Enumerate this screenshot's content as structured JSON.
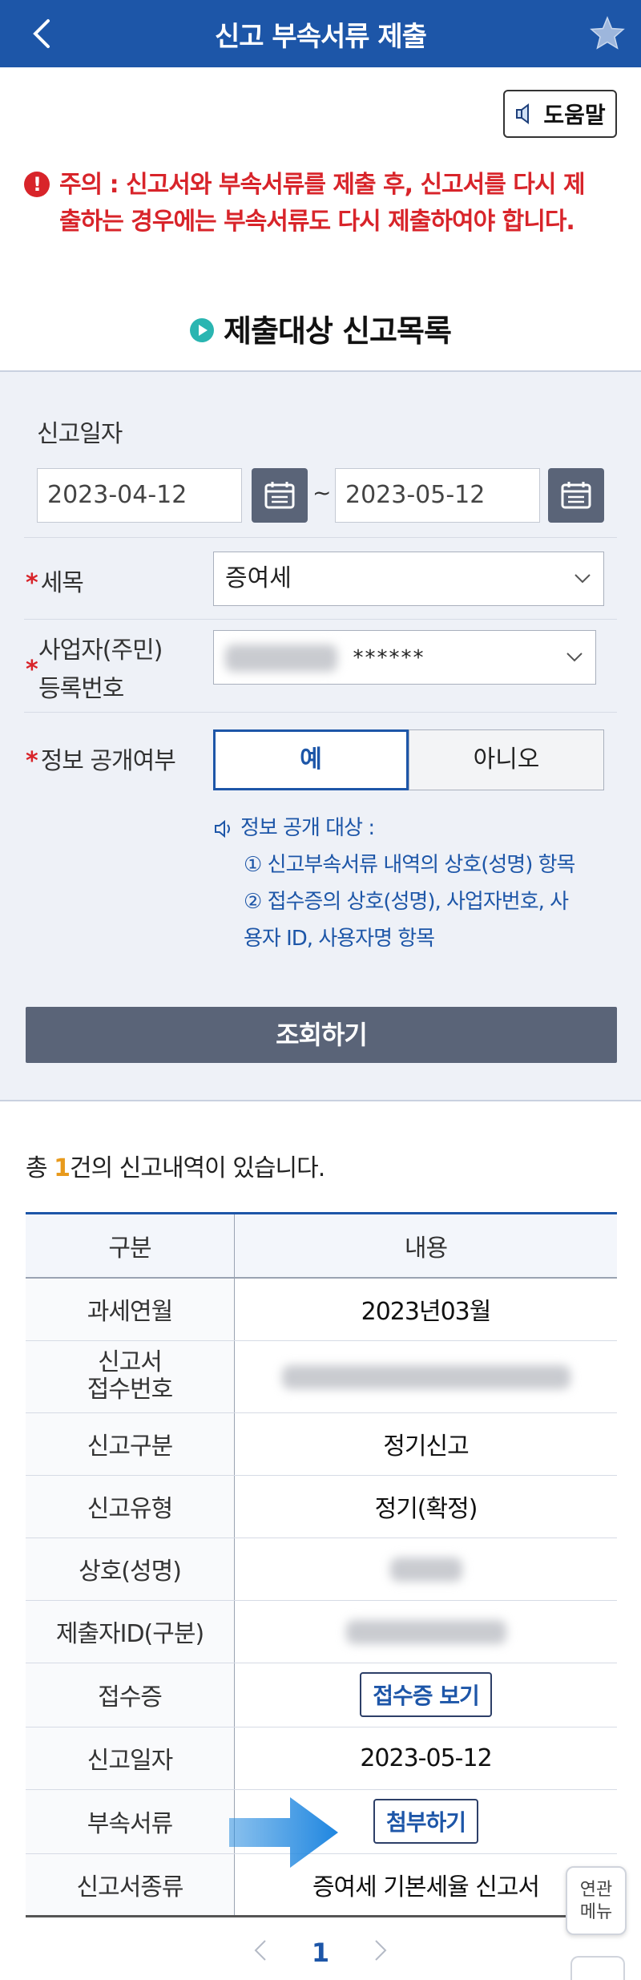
{
  "header": {
    "title": "신고 부속서류 제출"
  },
  "help_button": {
    "label": "도움말"
  },
  "warning": {
    "line1": "주의 : 신고서와 부속서류를 제출 후, 신고서를 다시 제",
    "line2": "출하는 경우에는 부속서류도 다시 제출하여야 합니다."
  },
  "section_title": "제출대상 신고목록",
  "form": {
    "date_label": "신고일자",
    "date_from": "2023-04-12",
    "date_sep": "~",
    "date_to": "2023-05-12",
    "tax_item_label": "세목",
    "tax_item_value": "증여세",
    "reg_no_label_1": "사업자(주민)",
    "reg_no_label_2": "등록번호",
    "reg_no_value": "******",
    "disclosure_label": "정보 공개여부",
    "disclosure_yes": "예",
    "disclosure_no": "아니오",
    "info_title": "정보 공개 대상 :",
    "info_item1": "① 신고부속서류 내역의 상호(성명) 항목",
    "info_item2a": "② 접수증의 상호(성명), 사업자번호, 사",
    "info_item2b": "용자 ID, 사용자명 항목",
    "search_button": "조회하기"
  },
  "result": {
    "count_prefix": "총 ",
    "count": "1",
    "count_suffix": "건의 신고내역이 있습니다.",
    "col_category": "구분",
    "col_content": "내용",
    "rows": [
      {
        "label": "과세연월",
        "value": "2023년03월"
      },
      {
        "label": "신고서 접수번호",
        "label1": "신고서",
        "label2": "접수번호",
        "value": ""
      },
      {
        "label": "신고구분",
        "value": "정기신고"
      },
      {
        "label": "신고유형",
        "value": "정기(확정)"
      },
      {
        "label": "상호(성명)",
        "value": ""
      },
      {
        "label": "제출자ID(구분)",
        "value": ""
      },
      {
        "label": "접수증",
        "value": "접수증 보기"
      },
      {
        "label": "신고일자",
        "value": "2023-05-12"
      },
      {
        "label": "부속서류",
        "value": "첨부하기"
      },
      {
        "label": "신고서종류",
        "value": "증여세 기본세율 신고서"
      }
    ]
  },
  "pager": {
    "current": "1"
  },
  "related_menu": {
    "line1": "연관",
    "line2": "메뉴"
  },
  "colors": {
    "brand": "#1d56a8",
    "warning": "#d8242a",
    "accent": "#2ab5b1",
    "button": "#5a6478"
  },
  "icons": [
    "back-icon",
    "star-icon",
    "speaker-icon",
    "alert-icon",
    "play-icon",
    "calendar-icon",
    "chevron-down-icon",
    "arrow-right-icon"
  ]
}
